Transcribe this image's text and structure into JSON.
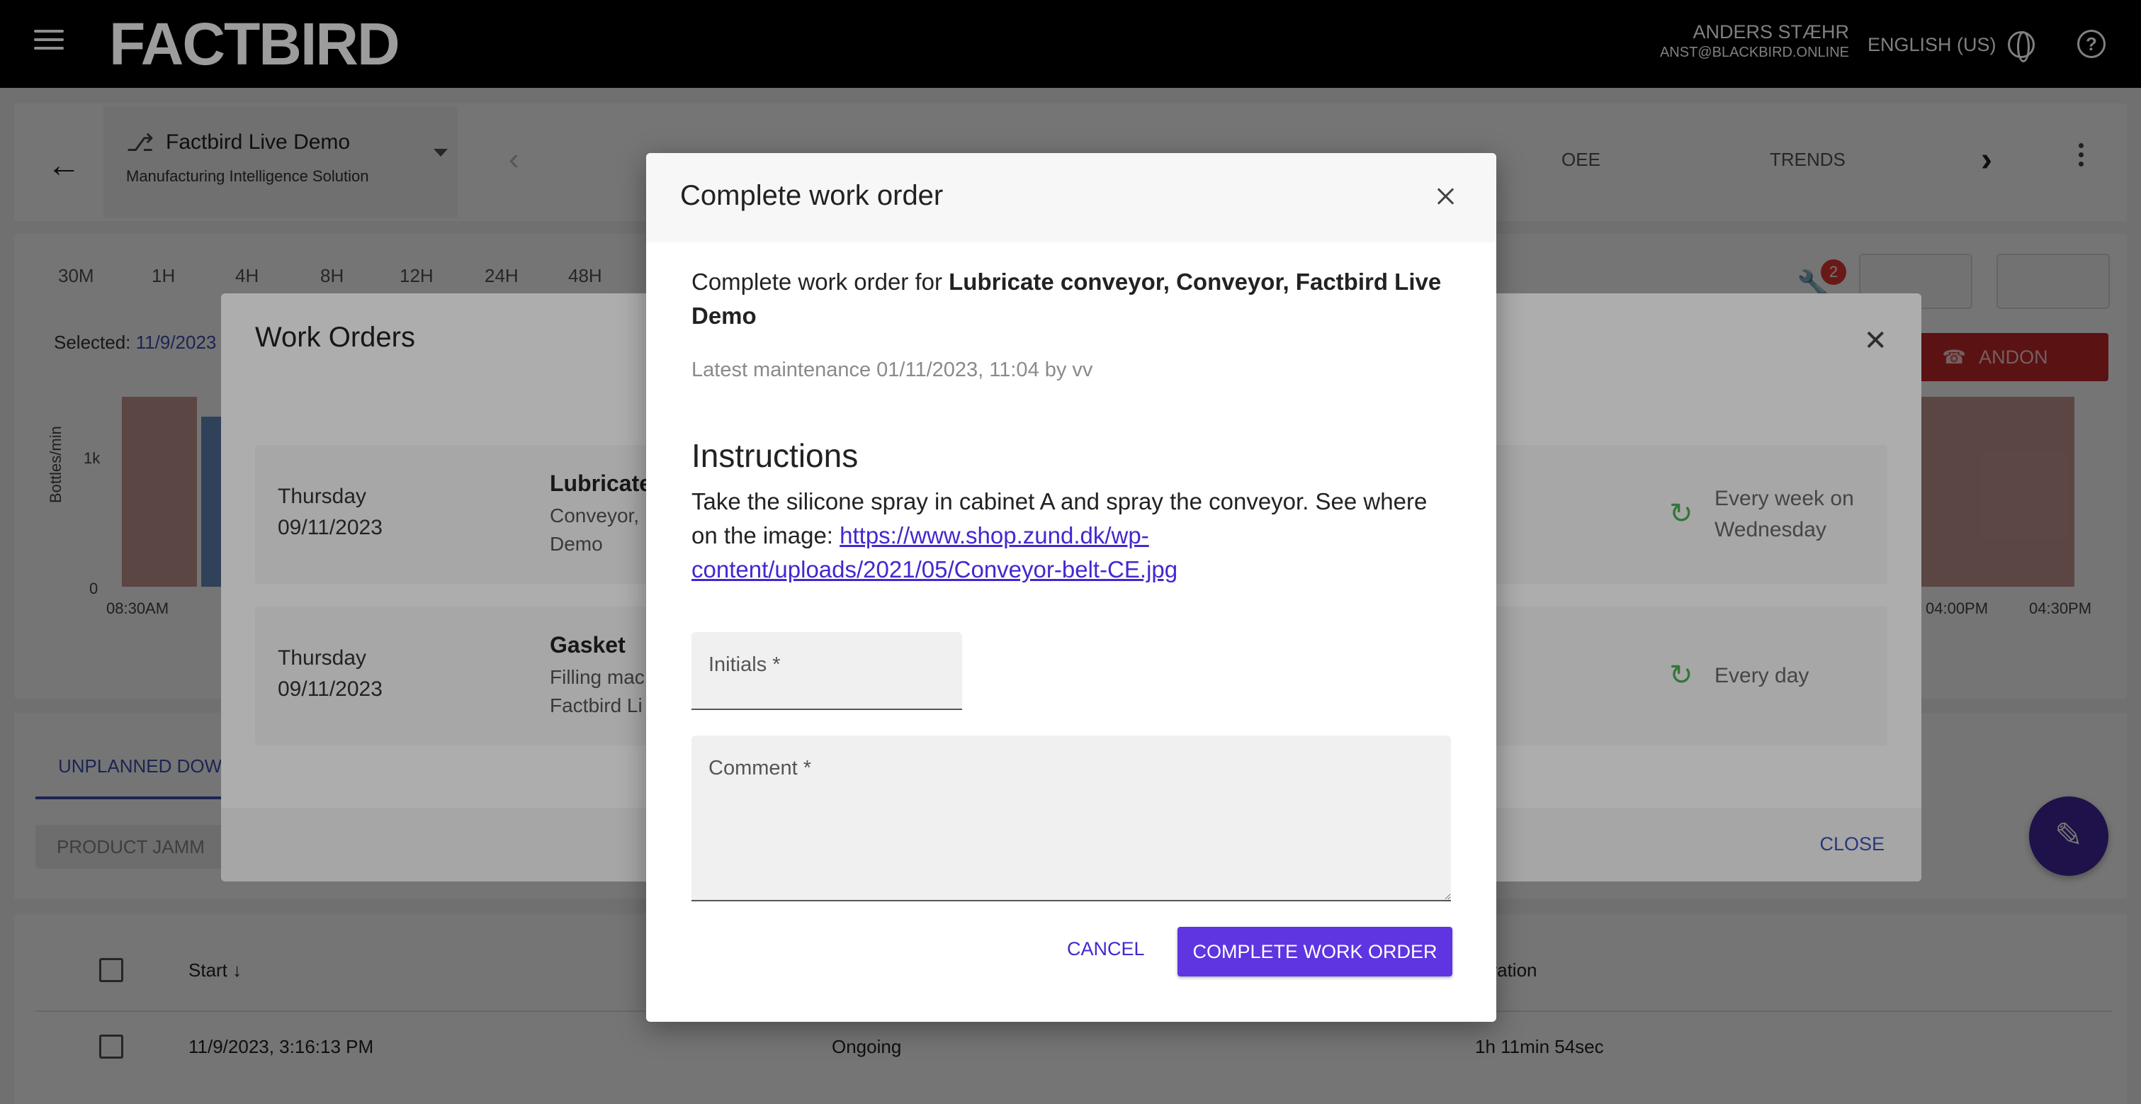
{
  "header": {
    "logo": "FACTBIRD",
    "user_name": "ANDERS STÆHR",
    "user_email": "ANST@BLACKBIRD.ONLINE",
    "language": "ENGLISH (US)"
  },
  "line": {
    "name": "Factbird Live Demo",
    "subtitle": "Manufacturing Intelligence Solution",
    "tabs": [
      "OEE",
      "TRENDS"
    ]
  },
  "chart": {
    "ranges": [
      "30M",
      "1H",
      "4H",
      "8H",
      "12H",
      "24H",
      "48H"
    ],
    "selected_label": "Selected:",
    "selected_value": "11/9/2023",
    "ylabel": "Bottles/min",
    "yticks": [
      "1k",
      "0"
    ],
    "xticks_left": [
      "08:30AM"
    ],
    "xticks_right": [
      "04:00PM",
      "04:30PM"
    ],
    "alert_count": "2",
    "andon_label": "ANDON"
  },
  "downtime": {
    "tab_label": "UNPLANNED DOWNTIME",
    "tab_visible": "UNPLANNED DOW",
    "chip_label": "PRODUCT JAMM",
    "columns": {
      "start": "Start",
      "duration": "Duration",
      "duration_visible": "uration"
    },
    "rows": [
      {
        "start": "11/9/2023, 3:16:13 PM",
        "status": "Ongoing",
        "duration": "1h 11min 54sec"
      }
    ]
  },
  "work_orders": {
    "title": "Work Orders",
    "close_label": "CLOSE",
    "items": [
      {
        "day": "Thursday",
        "date": "09/11/2023",
        "name": "Lubricate",
        "sub1": "Conveyor,",
        "sub2": "Demo",
        "frequency": "Every week on Wednesday",
        "freq1": "Every week on",
        "freq2": "Wednesday"
      },
      {
        "day": "Thursday",
        "date": "09/11/2023",
        "name": "Gasket",
        "sub1": "Filling mac",
        "sub2": "Factbird Li",
        "frequency": "Every day",
        "freq1": "Every day",
        "freq2": ""
      }
    ]
  },
  "complete_dialog": {
    "title": "Complete work order",
    "desc_prefix": "Complete work order for ",
    "desc_target": "Lubricate conveyor, Conveyor, Factbird Live Demo",
    "latest": "Latest maintenance 01/11/2023, 11:04 by vv",
    "instructions_heading": "Instructions",
    "instructions_text": "Take the silicone spray in cabinet A and spray the conveyor. See where on the image: ",
    "instructions_link": "https://www.shop.zund.dk/wp-content/uploads/2021/05/Conveyor-belt-CE.jpg",
    "initials_label": "Initials *",
    "comment_label": "Comment *",
    "cancel_label": "CANCEL",
    "submit_label": "COMPLETE WORK ORDER"
  }
}
